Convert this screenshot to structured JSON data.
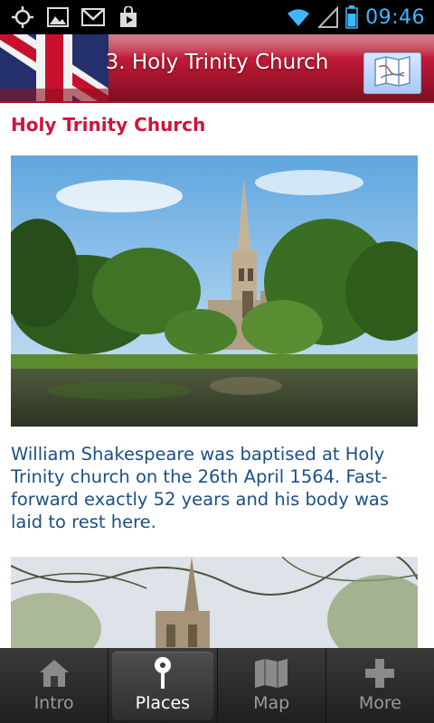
{
  "status_bar": {
    "time": "09:46",
    "left_icons": [
      "gps-icon",
      "image-icon",
      "gmail-icon",
      "play-store-icon"
    ],
    "right_icons": [
      "wifi-icon",
      "signal-icon",
      "battery-icon"
    ]
  },
  "header": {
    "title": "3. Holy Trinity Church",
    "map_button_icon": "map-icon"
  },
  "content": {
    "place_title": "Holy Trinity Church",
    "description": "William Shakespeare was baptised at Holy Trinity church on the 26th April 1564. Fast-forward exactly 52 years and his body was laid to rest here."
  },
  "bottom_nav": {
    "tabs": [
      {
        "label": "Intro",
        "icon": "house-icon",
        "active": false
      },
      {
        "label": "Places",
        "icon": "pin-icon",
        "active": true
      },
      {
        "label": "Map",
        "icon": "map-icon",
        "active": false
      },
      {
        "label": "More",
        "icon": "plus-icon",
        "active": false
      }
    ]
  },
  "colors": {
    "header_red": "#b31630",
    "title_red": "#d0143c",
    "description_blue": "#1b4f88",
    "clock_blue": "#3db8ff"
  }
}
